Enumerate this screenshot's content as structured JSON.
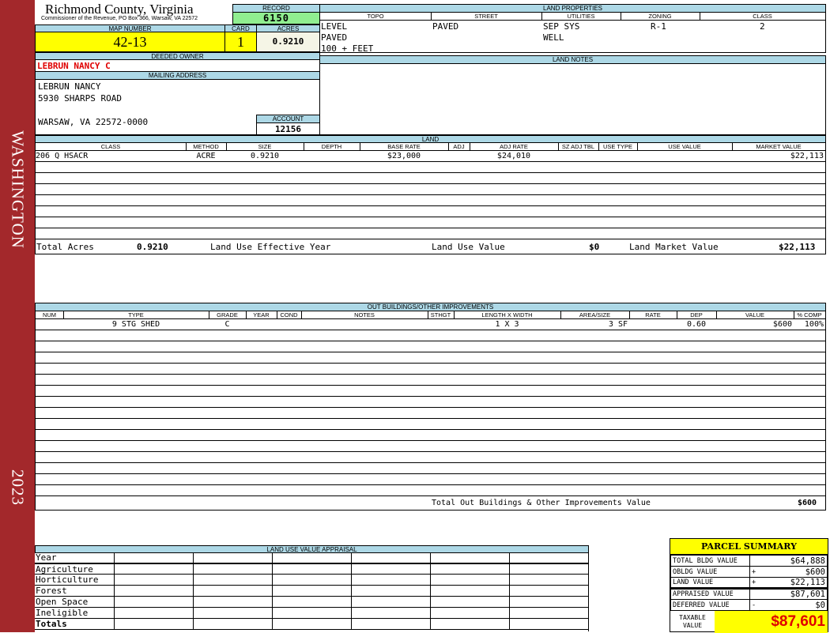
{
  "sidebar": {
    "name": "WASHINGTON",
    "year": "2023"
  },
  "header": {
    "county": "Richmond County, Virginia",
    "office": "Commissioner of the Revenue, PO Box 366, Warsaw, VA 22572"
  },
  "record": {
    "label": "RECORD",
    "value": "6150"
  },
  "map": {
    "label": "MAP NUMBER",
    "value": "42-13"
  },
  "card": {
    "label": "CARD",
    "value": "1"
  },
  "acres": {
    "label": "ACRES",
    "value": "0.9210"
  },
  "owner": {
    "label": "DEEDED OWNER",
    "value": "LEBRUN NANCY C"
  },
  "mailing": {
    "label": "MAILING ADDRESS",
    "line1": "LEBRUN NANCY",
    "line2": "5930 SHARPS ROAD",
    "line3": "WARSAW, VA 22572-0000"
  },
  "account": {
    "label": "ACCOUNT",
    "value": "12156"
  },
  "land_properties": {
    "label": "LAND PROPERTIES",
    "topo_label": "TOPO",
    "street_label": "STREET",
    "utilities_label": "UTILITIES",
    "zoning_label": "ZONING",
    "class_label": "CLASS",
    "topo": [
      "LEVEL",
      "PAVED",
      "100 + FEET"
    ],
    "street": [
      "PAVED"
    ],
    "utilities": [
      "SEP SYS",
      "WELL"
    ],
    "zoning": "R-1",
    "class": "2"
  },
  "land_notes": {
    "label": "LAND NOTES"
  },
  "land": {
    "label": "LAND",
    "columns": [
      "CLASS",
      "METHOD",
      "SIZE",
      "DEPTH",
      "BASE RATE",
      "ADJ",
      "ADJ RATE",
      "SZ ADJ TBL",
      "USE TYPE",
      "USE VALUE",
      "MARKET VALUE"
    ],
    "rows": [
      [
        "206 Q HSACR",
        "ACRE",
        "0.9210",
        "",
        "$23,000",
        "",
        "$24,010",
        "",
        "",
        "",
        "$22,113"
      ]
    ],
    "totals": {
      "acres_label": "Total Acres",
      "acres": "0.9210",
      "effective_year_label": "Land Use Effective Year",
      "effective_year": "",
      "use_value_label": "Land Use Value",
      "use_value": "$0",
      "market_label": "Land Market Value",
      "market": "$22,113"
    }
  },
  "outbuildings": {
    "label": "OUT BUILDINGS/OTHER IMPROVEMENTS",
    "columns": [
      "NUM",
      "TYPE",
      "GRADE",
      "YEAR",
      "COND",
      "NOTES",
      "STHGT",
      "LENGTH X WIDTH",
      "AREA/SIZE",
      "RATE",
      "DEP",
      "VALUE",
      "% COMP"
    ],
    "rows": [
      [
        "",
        "9 STG SHED",
        "C",
        "",
        "",
        "",
        "",
        "1 X 3",
        "3 SF",
        "",
        "0.60",
        "$600",
        "100%"
      ]
    ],
    "total_label": "Total Out Buildings & Other Improvements Value",
    "total": "$600"
  },
  "land_use": {
    "label": "LAND USE VALUE APPRAISAL",
    "rows": [
      "Year",
      "Agriculture",
      "Horticulture",
      "Forest",
      "Open Space",
      "Ineligible",
      "Totals"
    ]
  },
  "summary": {
    "title": "PARCEL SUMMARY",
    "rows": [
      {
        "label": "TOTAL BLDG VALUE",
        "op": "",
        "value": "$64,888"
      },
      {
        "label": "OBLDG VALUE",
        "op": "+",
        "value": "$600"
      },
      {
        "label": "LAND VALUE",
        "op": "+",
        "value": "$22,113"
      },
      {
        "label": "APPRAISED VALUE",
        "op": "",
        "value": "$87,601"
      },
      {
        "label": "DEFERRED VALUE",
        "op": "-",
        "value": "$0"
      }
    ],
    "taxable_label": "TAXABLE VALUE",
    "taxable": "$87,601"
  },
  "colors": {
    "header_bar": "#add8e6",
    "sidebar": "#a3282b",
    "highlight": "#ffff00",
    "record": "#90ee90",
    "owner": "#e00000"
  }
}
